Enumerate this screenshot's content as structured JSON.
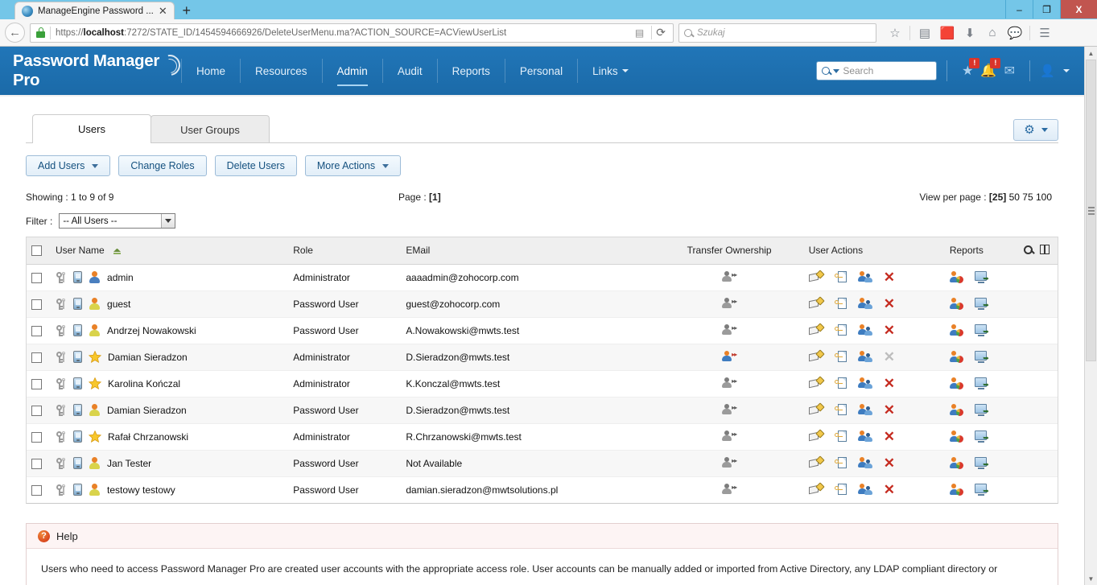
{
  "browser": {
    "tab_title": "ManageEngine Password ...",
    "tab_close": "✕",
    "new_tab": "+",
    "url_prefix": "https://",
    "url_host": "localhost",
    "url_rest": ":7272/STATE_ID/1454594666926/DeleteUserMenu.ma?ACTION_SOURCE=ACViewUserList",
    "reader_icon": "▤",
    "reload_icon": "⟳",
    "search_placeholder": "Szukaj",
    "toolbar_icons": [
      "☆",
      "▤",
      "▼",
      "↓",
      "⌂",
      "●",
      "☰"
    ],
    "window_minimize": "–",
    "window_restore": "❐",
    "window_close": "X"
  },
  "app": {
    "logo": "Password Manager Pro",
    "nav": [
      {
        "label": "Home",
        "active": false
      },
      {
        "label": "Resources",
        "active": false
      },
      {
        "label": "Admin",
        "active": true
      },
      {
        "label": "Audit",
        "active": false
      },
      {
        "label": "Reports",
        "active": false
      },
      {
        "label": "Personal",
        "active": false
      },
      {
        "label": "Links",
        "active": false,
        "dropdown": true
      }
    ],
    "search_placeholder": "Search",
    "star_badge": "!",
    "bell_badge": "!",
    "mail_icon": "✉",
    "user_icon": "☰"
  },
  "tabs": [
    {
      "label": "Users",
      "active": true
    },
    {
      "label": "User Groups",
      "active": false
    }
  ],
  "toolbar": {
    "add_users": "Add Users",
    "change_roles": "Change Roles",
    "delete_users": "Delete Users",
    "more_actions": "More Actions",
    "gear_icon": "⚙"
  },
  "status": {
    "showing": "Showing : 1 to 9 of 9",
    "page_label": "Page : ",
    "page_value": "[1]",
    "view_per_page_label": "View per page : ",
    "view_per_page_current": "[25]",
    "view_per_page_options": "50 75 100",
    "filter_label": "Filter :",
    "filter_value": "-- All Users --"
  },
  "table": {
    "columns": [
      "User Name",
      "Role",
      "EMail",
      "Transfer Ownership",
      "User Actions",
      "Reports"
    ],
    "rows": [
      {
        "name": "admin",
        "role": "Administrator",
        "email": "aaaadmin@zohocorp.com",
        "avatar": "person-blue",
        "transfer_active": false,
        "delete_disabled": false
      },
      {
        "name": "guest",
        "role": "Password User",
        "email": "guest@zohocorp.com",
        "avatar": "person-yellow",
        "transfer_active": false,
        "delete_disabled": false
      },
      {
        "name": "Andrzej Nowakowski",
        "role": "Password User",
        "email": "A.Nowakowski@mwts.test",
        "avatar": "person-yellow",
        "transfer_active": false,
        "delete_disabled": false
      },
      {
        "name": "Damian Sieradzon",
        "role": "Administrator",
        "email": "D.Sieradzon@mwts.test",
        "avatar": "star",
        "transfer_active": true,
        "delete_disabled": true
      },
      {
        "name": "Karolina Kończal",
        "role": "Administrator",
        "email": "K.Konczal@mwts.test",
        "avatar": "star",
        "transfer_active": false,
        "delete_disabled": false
      },
      {
        "name": "Damian Sieradzon",
        "role": "Password User",
        "email": "D.Sieradzon@mwts.test",
        "avatar": "person-yellow",
        "transfer_active": false,
        "delete_disabled": false
      },
      {
        "name": "Rafał Chrzanowski",
        "role": "Administrator",
        "email": "R.Chrzanowski@mwts.test",
        "avatar": "star",
        "transfer_active": false,
        "delete_disabled": false
      },
      {
        "name": "Jan Tester",
        "role": "Password User",
        "email": "Not Available",
        "avatar": "person-yellow",
        "transfer_active": false,
        "delete_disabled": false
      },
      {
        "name": "testowy testowy",
        "role": "Password User",
        "email": "damian.sieradzon@mwtsolutions.pl",
        "avatar": "person-yellow",
        "transfer_active": false,
        "delete_disabled": false
      }
    ],
    "delete_glyph": "✕"
  },
  "help": {
    "icon": "?",
    "title": "Help",
    "text": "Users who need to access Password Manager Pro are created user accounts with the appropriate access role. User accounts can be manually added or imported from Active Directory, any LDAP compliant directory or"
  },
  "colors": {
    "header_blue": "#1b6aa8",
    "accent_link": "#15517f",
    "delete_red": "#c52b20",
    "badge_red": "#d9352b",
    "browser_titlebar": "#74c6e8"
  }
}
